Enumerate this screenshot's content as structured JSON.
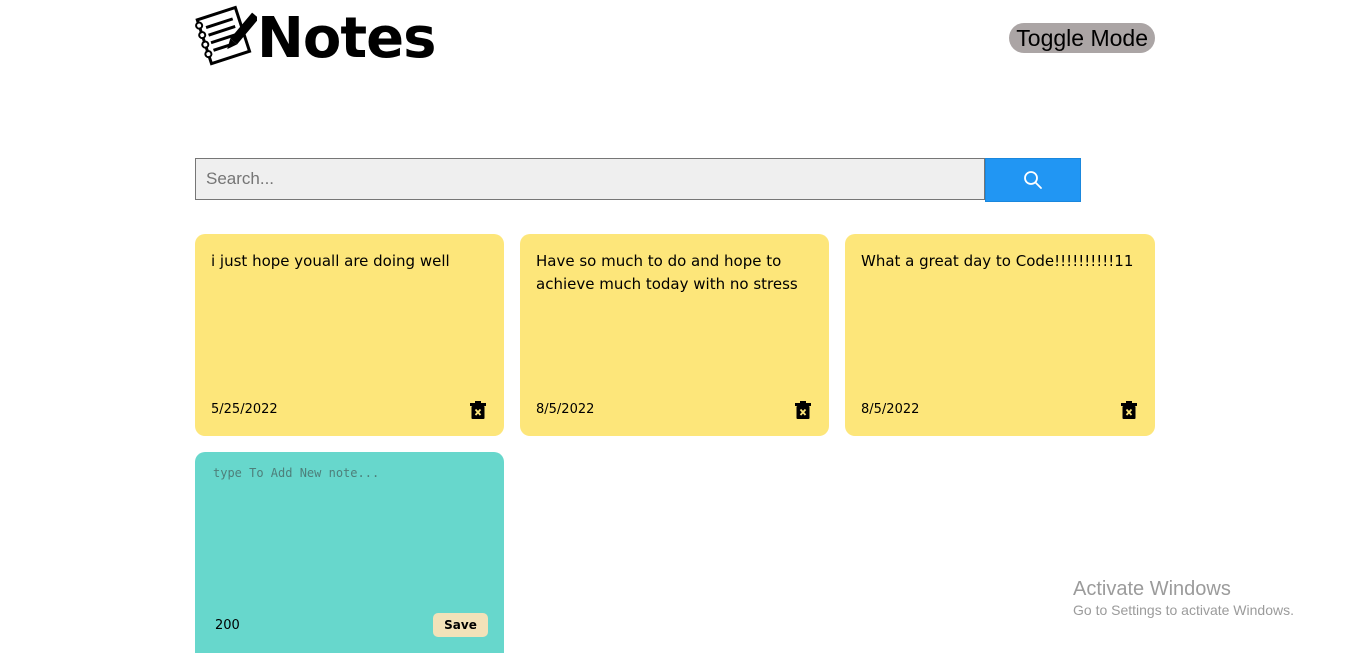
{
  "header": {
    "title": "Notes",
    "toggle_label": "Toggle Mode",
    "logo_icon": "notepad-pencil-icon"
  },
  "search": {
    "placeholder": "Search...",
    "value": "",
    "button_icon": "search-icon",
    "button_color": "#2196f3"
  },
  "notes": [
    {
      "text": "i just hope youall are doing well",
      "date": "5/25/2022",
      "delete_icon": "trash-icon"
    },
    {
      "text": "Have so much to do and hope to achieve much today with no stress",
      "date": "8/5/2022",
      "delete_icon": "trash-icon"
    },
    {
      "text": "What a great day to Code!!!!!!!!!!11",
      "date": "8/5/2022",
      "delete_icon": "trash-icon"
    }
  ],
  "new_note": {
    "placeholder": "type To Add New note...",
    "value": "",
    "chars_remaining": "200",
    "save_label": "Save",
    "color": "#67d7cc"
  },
  "note_color": "#fde67a",
  "watermark": {
    "title": "Activate Windows",
    "subtitle": "Go to Settings to activate Windows."
  }
}
